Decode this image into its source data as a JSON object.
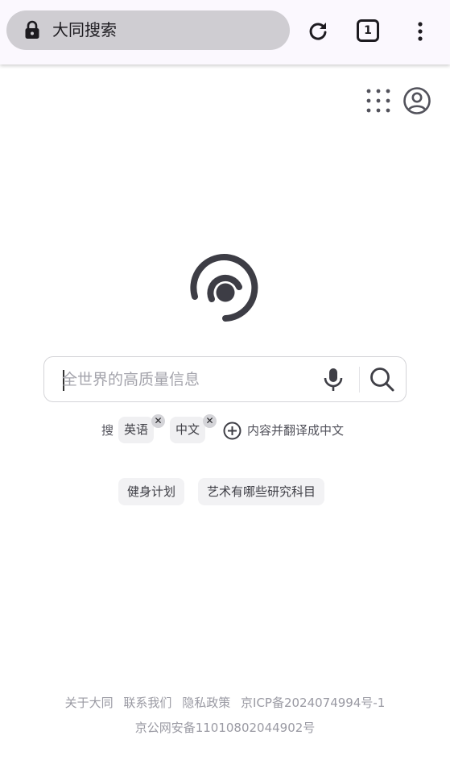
{
  "browser": {
    "url_text": "大同搜索",
    "tab_count": "1"
  },
  "colors": {
    "logo": "#3d3d45",
    "chrome_bg": "#fbf8fe",
    "url_pill": "#cfcdd2"
  },
  "search": {
    "placeholder": "全世界的高质量信息",
    "value": ""
  },
  "language": {
    "prefix": "搜",
    "chips": [
      {
        "label": "英语",
        "remove": "✕"
      },
      {
        "label": "中文",
        "remove": "✕"
      }
    ],
    "suffix": "内容并翻译成中文"
  },
  "suggestions": [
    {
      "label": "健身计划"
    },
    {
      "label": "艺术有哪些研究科目"
    }
  ],
  "footer": {
    "links": [
      {
        "label": "关于大同"
      },
      {
        "label": "联系我们"
      },
      {
        "label": "隐私政策"
      },
      {
        "label": "京ICP备2024074994号-1"
      }
    ],
    "security_record": "京公网安备11010802044902号"
  }
}
